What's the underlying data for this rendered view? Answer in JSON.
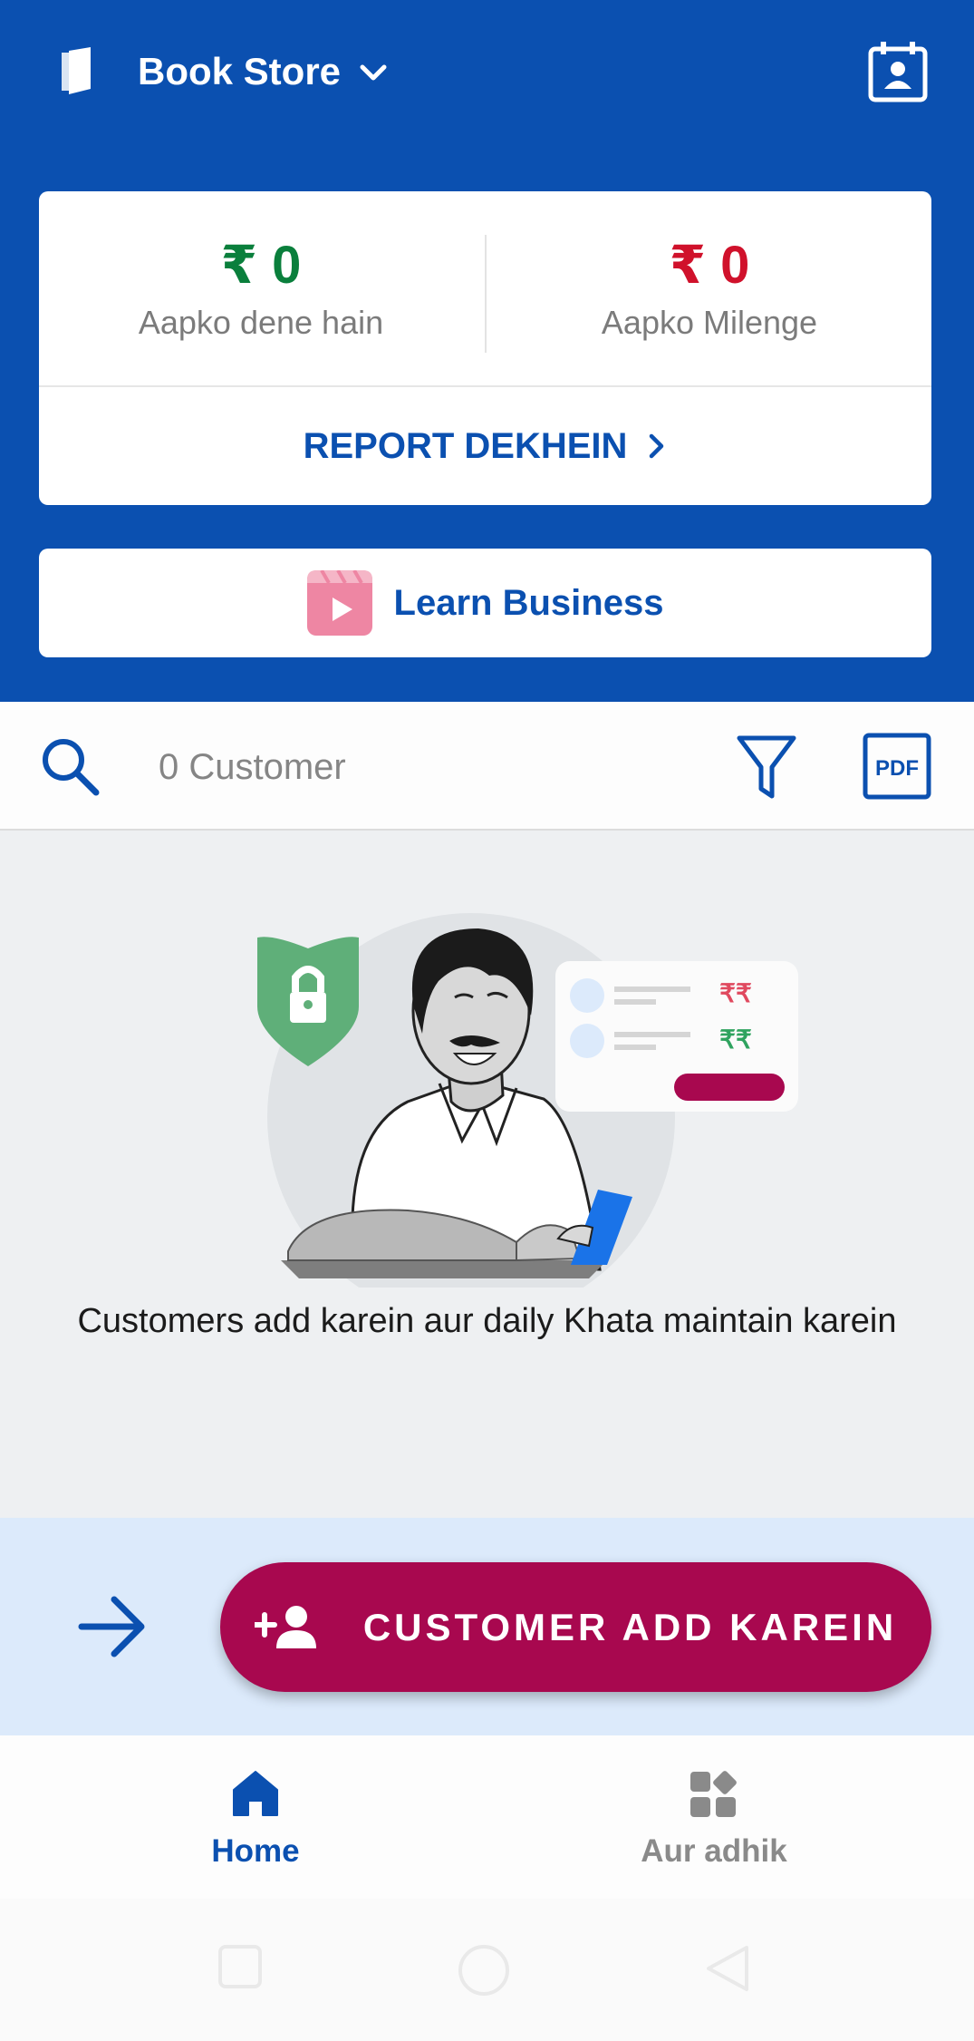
{
  "header": {
    "store_name": "Book Store",
    "icons": [
      "book-icon",
      "chevron-down-icon",
      "contact-calendar-icon"
    ]
  },
  "summary": {
    "give": {
      "amount": "₹ 0",
      "label": "Aapko dene hain",
      "color": "#0a7f3c"
    },
    "get": {
      "amount": "₹ 0",
      "label": "Aapko Milenge",
      "color": "#d0112b"
    },
    "report_label": "REPORT DEKHEIN"
  },
  "learn": {
    "label": "Learn Business"
  },
  "search": {
    "count_text": "0 Customer"
  },
  "empty_state": {
    "illustration": {
      "rupee_red": "₹₹",
      "rupee_green": "₹₹"
    },
    "message": "Customers add karein aur daily Khata maintain karein"
  },
  "cta": {
    "label": "CUSTOMER ADD KAREIN"
  },
  "bottom_nav": {
    "items": [
      {
        "label": "Home",
        "icon": "home-icon",
        "active": true
      },
      {
        "label": "Aur adhik",
        "icon": "apps-icon",
        "active": false
      }
    ]
  },
  "colors": {
    "primary": "#0b50b0",
    "accent": "#a8084f",
    "green": "#0a7f3c",
    "red": "#d0112b"
  }
}
